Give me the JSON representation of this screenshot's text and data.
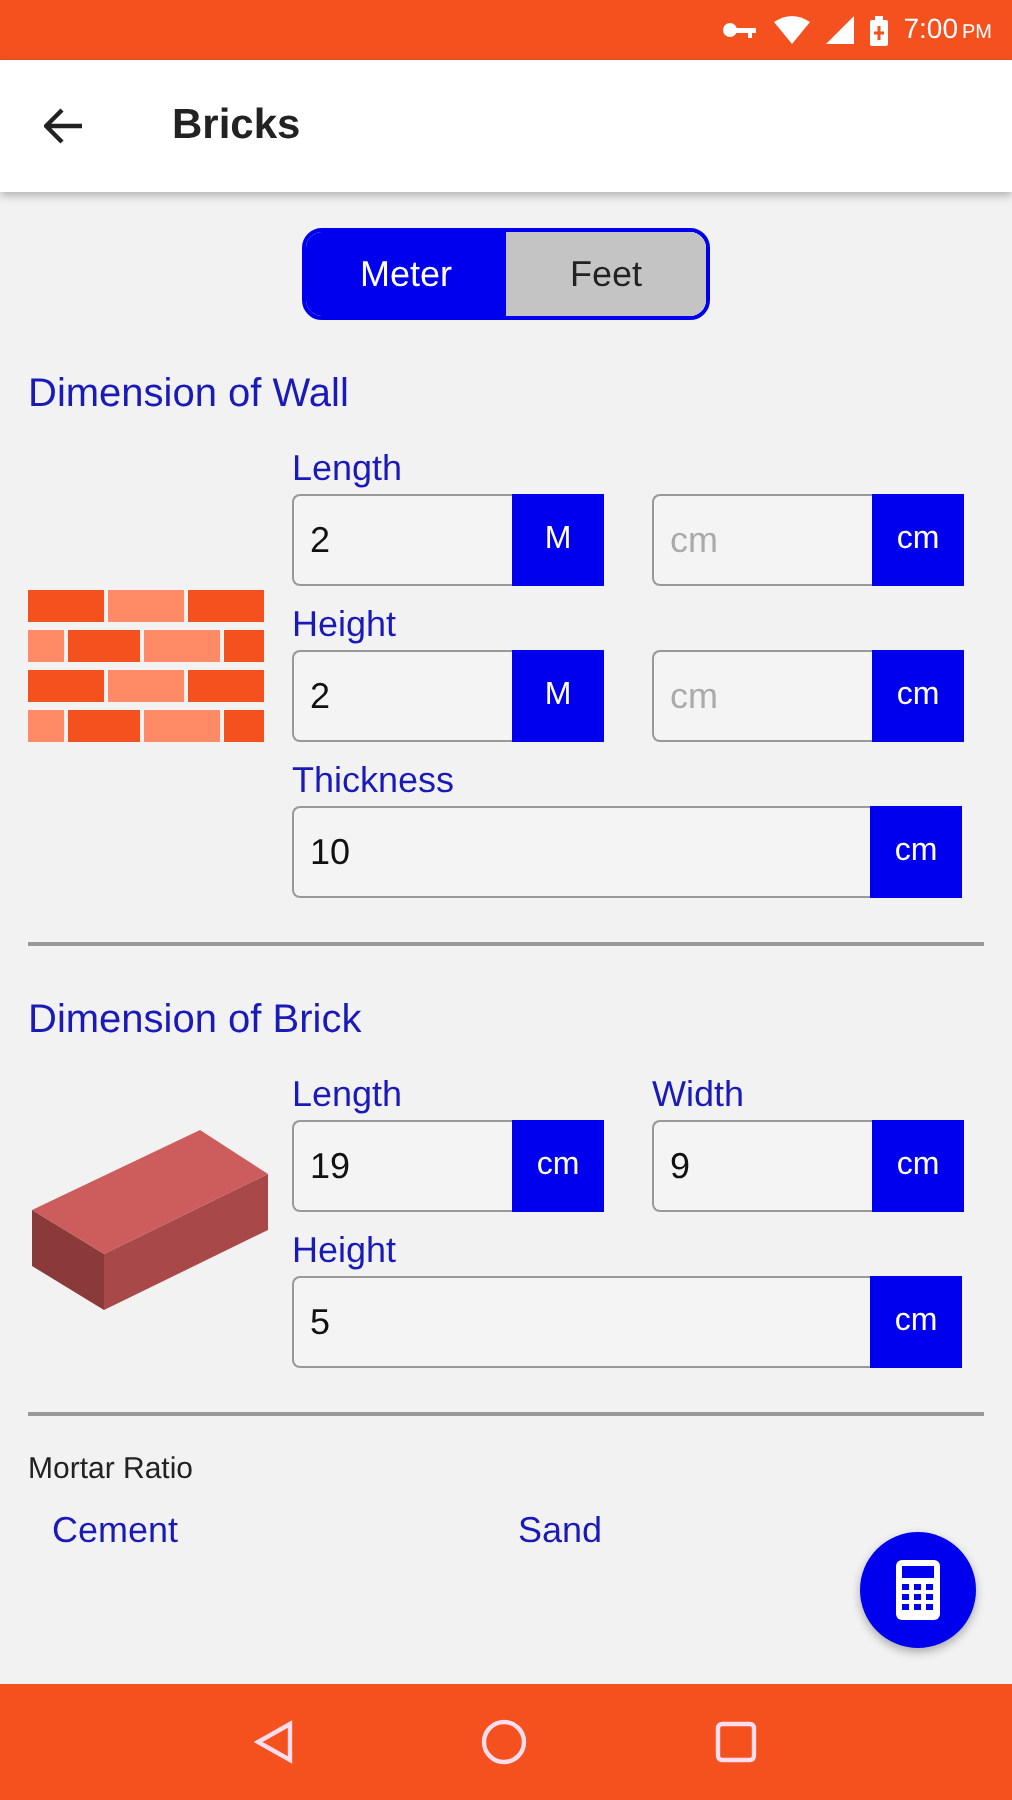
{
  "status_bar": {
    "time": "7:00",
    "ampm": "PM"
  },
  "app_bar": {
    "title": "Bricks"
  },
  "unit_toggle": [
    {
      "label": "Meter",
      "selected": true
    },
    {
      "label": "Feet",
      "selected": false
    }
  ],
  "sections": [
    {
      "title": "Dimension of Wall",
      "kind": "wall",
      "rows": [
        {
          "fields": [
            {
              "label": "Length",
              "value": "2",
              "unit": "M"
            },
            {
              "placeholder": "cm",
              "unit": "cm"
            }
          ]
        },
        {
          "fields": [
            {
              "label": "Height",
              "value": "2",
              "unit": "M"
            },
            {
              "placeholder": "cm",
              "unit": "cm"
            }
          ]
        },
        {
          "fields": [
            {
              "label": "Thickness",
              "value": "10",
              "unit": "cm"
            }
          ]
        }
      ]
    },
    {
      "title": "Dimension of Brick",
      "kind": "brick",
      "rows": [
        {
          "fields": [
            {
              "label": "Length",
              "value": "19",
              "unit": "cm"
            },
            {
              "label": "Width",
              "value": "9",
              "unit": "cm"
            }
          ]
        },
        {
          "fields": [
            {
              "label": "Height",
              "value": "5",
              "unit": "cm"
            }
          ]
        }
      ]
    }
  ],
  "mortar": {
    "title": "Mortar Ratio",
    "labels": [
      "Cement",
      "Sand"
    ]
  }
}
